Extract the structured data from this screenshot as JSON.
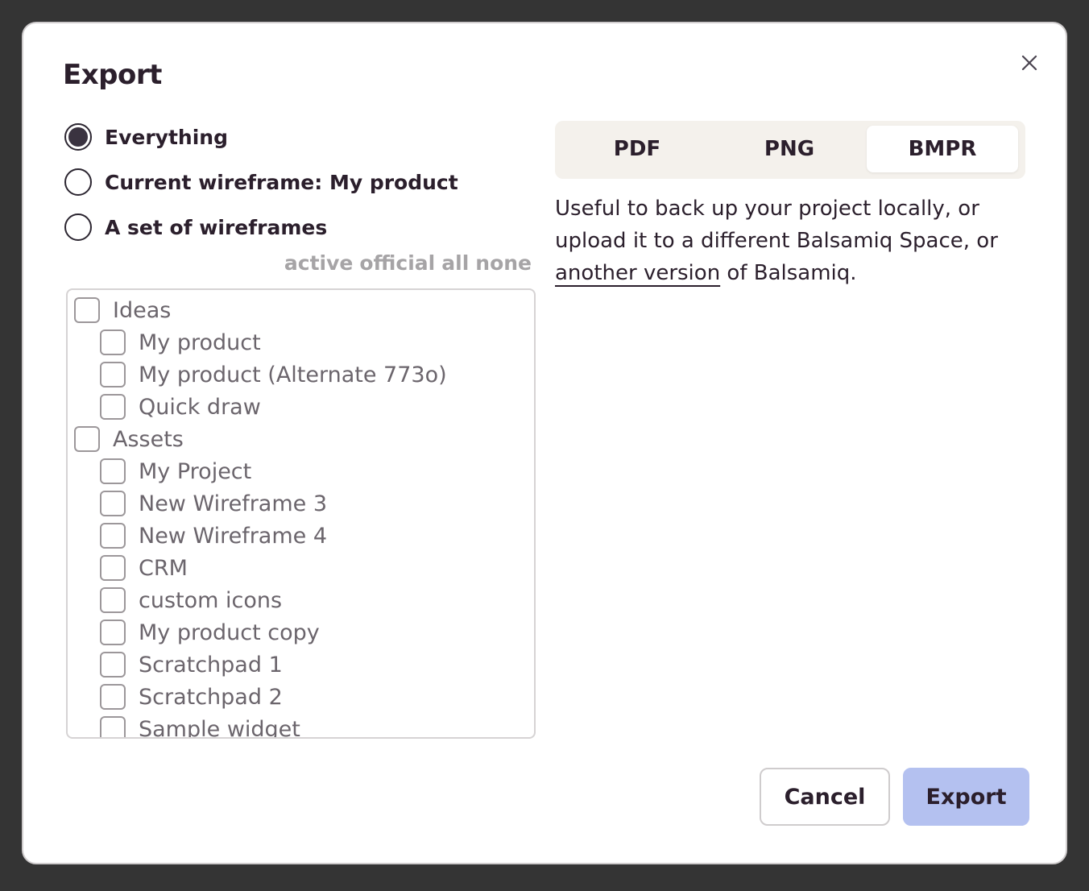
{
  "dialog": {
    "title": "Export",
    "close_icon": "close-icon"
  },
  "scope_options": [
    {
      "label": "Everything",
      "selected": true
    },
    {
      "label": "Current wireframe: My product",
      "selected": false
    },
    {
      "label": "A set of wireframes",
      "selected": false
    }
  ],
  "filters": [
    "active",
    "official",
    "all",
    "none"
  ],
  "wireframe_tree": [
    {
      "label": "Ideas",
      "level": 0,
      "checked": false
    },
    {
      "label": "My product",
      "level": 1,
      "checked": false
    },
    {
      "label": "My product (Alternate 773o)",
      "level": 1,
      "checked": false
    },
    {
      "label": "Quick draw",
      "level": 1,
      "checked": false
    },
    {
      "label": "Assets",
      "level": 0,
      "checked": false
    },
    {
      "label": "My Project",
      "level": 1,
      "checked": false
    },
    {
      "label": "New Wireframe 3",
      "level": 1,
      "checked": false
    },
    {
      "label": "New Wireframe 4",
      "level": 1,
      "checked": false
    },
    {
      "label": "CRM",
      "level": 1,
      "checked": false
    },
    {
      "label": "custom icons",
      "level": 1,
      "checked": false
    },
    {
      "label": "My product copy",
      "level": 1,
      "checked": false
    },
    {
      "label": "Scratchpad 1",
      "level": 1,
      "checked": false
    },
    {
      "label": "Scratchpad 2",
      "level": 1,
      "checked": false
    },
    {
      "label": "Sample widget",
      "level": 1,
      "checked": false
    }
  ],
  "formats": {
    "tabs": [
      "PDF",
      "PNG",
      "BMPR"
    ],
    "selected": "BMPR"
  },
  "description": {
    "text_before": "Useful to back up your project locally, or upload it to a different Balsamiq Space, or ",
    "link": "another version",
    "text_after": " of Balsamiq."
  },
  "buttons": {
    "cancel": "Cancel",
    "export": "Export"
  },
  "colors": {
    "backdrop": "#343434",
    "primary_button": "#b4c1f0",
    "segmented_bg": "#f4f1ec",
    "text": "#2b1f2c"
  }
}
